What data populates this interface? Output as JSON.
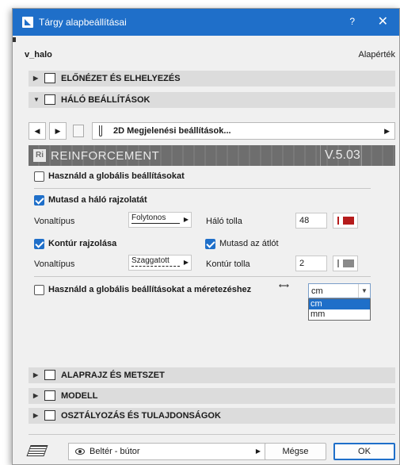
{
  "window": {
    "title": "Tárgy alapbeállításai",
    "help": "?",
    "close": "✕"
  },
  "header": {
    "name": "v_halo",
    "default_label": "Alapérték"
  },
  "sections": {
    "preview": "ELŐNÉZET ÉS ELHELYEZÉS",
    "mesh": "HÁLÓ BEÁLLÍTÁSOK",
    "floorplan": "ALAPRAJZ ÉS METSZET",
    "model": "MODELL",
    "classification": "OSZTÁLYOZÁS ÉS TULAJDONSÁGOK"
  },
  "nav": {
    "page_label": "2D Megjelenési beállítások..."
  },
  "banner": {
    "name": "REINFORCEMENT",
    "version": "V.5.03",
    "logo": "Ri"
  },
  "options": {
    "use_global": {
      "label": "Használd a globális beállításokat",
      "checked": false
    },
    "show_mesh": {
      "label": "Mutasd a háló rajzolatát",
      "checked": true
    },
    "mesh_linetype_label": "Vonaltípus",
    "mesh_linetype_value": "Folytonos",
    "mesh_pen_label": "Háló tolla",
    "mesh_pen_value": "48",
    "mesh_pen_color": "#b51c1c",
    "contour": {
      "label": "Kontúr rajzolása",
      "checked": true
    },
    "show_diagonal": {
      "label": "Mutasd az átlót",
      "checked": true
    },
    "contour_linetype_label": "Vonaltípus",
    "contour_linetype_value": "Szaggatott",
    "contour_pen_label": "Kontúr tolla",
    "contour_pen_value": "2",
    "contour_pen_color": "#8a8a8a",
    "use_global_dims": {
      "label": "Használd a globális beállításokat a méretezéshez",
      "checked": false
    },
    "unit_selected": "cm",
    "unit_options": [
      "cm",
      "mm"
    ]
  },
  "bottom": {
    "layer": "Beltér - bútor",
    "cancel": "Mégse",
    "ok": "OK"
  },
  "colors": {
    "titlebar": "#1f6fc9",
    "accent": "#1f6fc9"
  }
}
